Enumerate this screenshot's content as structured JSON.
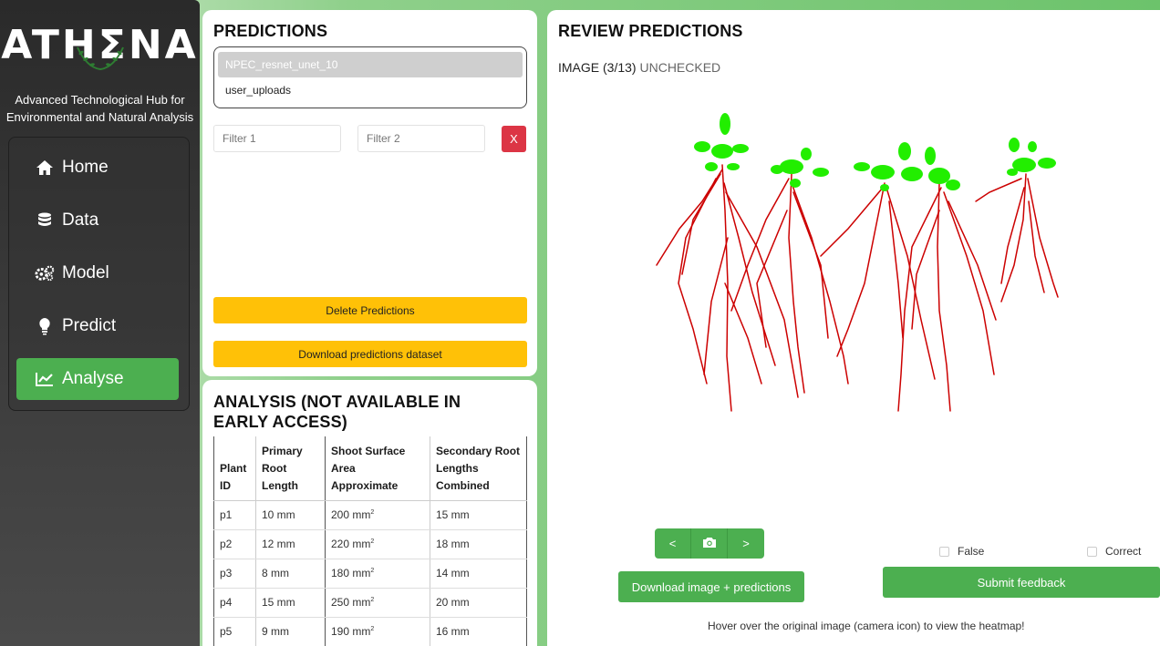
{
  "sidebar": {
    "logo": "ATHΣNA",
    "tagline_line1": "Advanced Technological Hub for",
    "tagline_line2": "Environmental and Natural Analysis",
    "items": [
      {
        "label": "Home",
        "icon": "home-icon"
      },
      {
        "label": "Data",
        "icon": "database-icon"
      },
      {
        "label": "Model",
        "icon": "gears-icon"
      },
      {
        "label": "Predict",
        "icon": "lightbulb-icon"
      },
      {
        "label": "Analyse",
        "icon": "chart-line-icon",
        "active": true
      }
    ]
  },
  "predictions": {
    "title": "PREDICTIONS",
    "options": [
      "NPEC_resnet_unet_10",
      "user_uploads"
    ],
    "selected": "NPEC_resnet_unet_10",
    "filter1_placeholder": "Filter 1",
    "filter2_placeholder": "Filter 2",
    "clear_label": "X",
    "delete_label": "Delete Predictions",
    "download_label": "Download predictions dataset"
  },
  "analysis": {
    "title_line1": "ANALYSIS (NOT AVAILABLE IN",
    "title_line2": "EARLY ACCESS)",
    "headers": [
      "Plant ID",
      "Primary Root Length",
      "Shoot Surface Area Approximate",
      "Secondary Root Lengths Combined"
    ],
    "rows": [
      {
        "id": "p1",
        "primary": "10 mm",
        "shoot": "200 mm",
        "secondary": "15 mm"
      },
      {
        "id": "p2",
        "primary": "12 mm",
        "shoot": "220 mm",
        "secondary": "18 mm"
      },
      {
        "id": "p3",
        "primary": "8 mm",
        "shoot": "180 mm",
        "secondary": "14 mm"
      },
      {
        "id": "p4",
        "primary": "15 mm",
        "shoot": "250 mm",
        "secondary": "20 mm"
      },
      {
        "id": "p5",
        "primary": "9 mm",
        "shoot": "190 mm",
        "secondary": "16 mm"
      }
    ],
    "sup": "2"
  },
  "review": {
    "title": "REVIEW PREDICTIONS",
    "image_label": "IMAGE (3/13)",
    "status": "UNCHECKED",
    "prev_label": "<",
    "next_label": ">",
    "download_label": "Download image + predictions",
    "false_label": "False",
    "correct_label": "Correct",
    "submit_label": "Submit feedback",
    "hint": "Hover over the original image (camera icon) to view the heatmap!"
  },
  "colors": {
    "accent_green": "#4caf50",
    "warning_yellow": "#ffc107",
    "danger_red": "#dc3545",
    "root_red": "#cc0000",
    "shoot_green": "#22ee00"
  }
}
